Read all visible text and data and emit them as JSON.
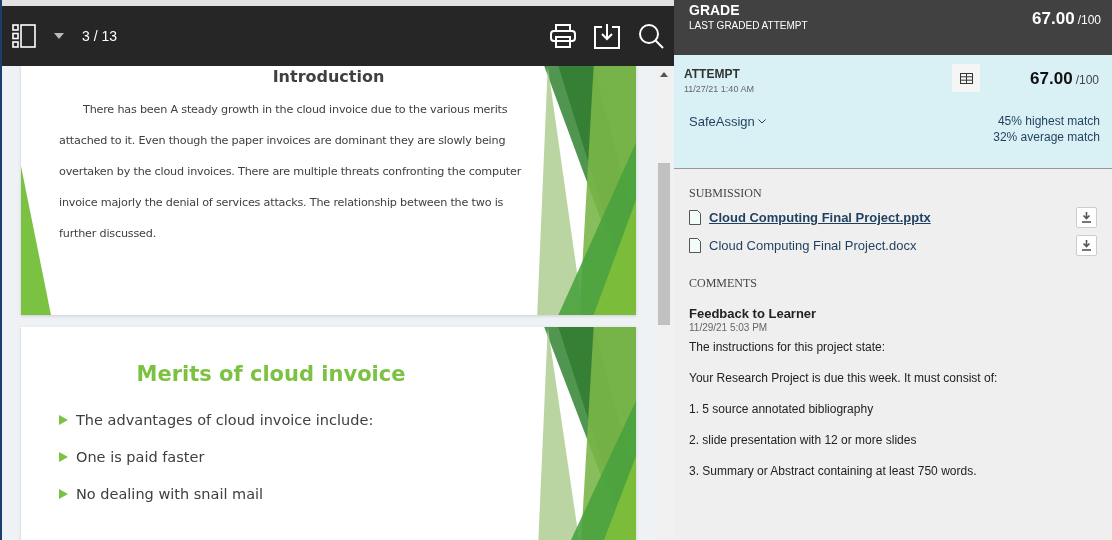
{
  "viewer": {
    "toolbar": {
      "page_indicator": "3 / 13"
    },
    "slides": [
      {
        "kind": "paragraph",
        "title": "Introduction",
        "text": "There has been A steady growth in the cloud invoice due to the various merits attached to it. Even though the paper invoices are dominant they are slowly being overtaken by the cloud invoices. There are multiple threats confronting the computer invoice majorly the denial of services attacks. The relationship between the two is further discussed."
      },
      {
        "kind": "bullets",
        "title": "Merits of cloud invoice",
        "bullets": [
          "The advantages of cloud invoice include:",
          "One is paid faster",
          "No dealing with snail mail"
        ]
      }
    ]
  },
  "grade": {
    "title": "GRADE",
    "subtitle": "LAST GRADED ATTEMPT",
    "score": "67.00",
    "out_of": "/100"
  },
  "attempt": {
    "title": "ATTEMPT",
    "date": "11/27/21 1:40 AM",
    "score": "67.00",
    "out_of": "/100",
    "safeassign": "SafeAssign",
    "matches": [
      "45% highest match",
      "32% average match"
    ]
  },
  "submission": {
    "heading": "SUBMISSION",
    "files": [
      {
        "name": "Cloud Computing Final Project.pptx",
        "selected": true
      },
      {
        "name": "Cloud Computing Final Project.docx",
        "selected": false
      }
    ]
  },
  "comments": {
    "heading": "COMMENTS",
    "author": "Feedback to Learner",
    "date": "11/29/21 5:03 PM",
    "paragraphs": [
      "The instructions for this project state:",
      "Your Research Project is due this week. It must consist of:",
      "1. 5 source annotated bibliography",
      "2. slide presentation with 12 or more slides",
      "3. Summary or Abstract containing at least 750 words."
    ]
  }
}
